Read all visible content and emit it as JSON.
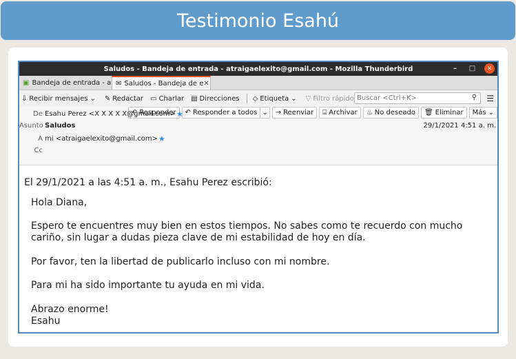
{
  "banner": {
    "title": "Testimonio Esahú"
  },
  "window": {
    "title": "Saludos - Bandeja de entrada - atraigaelexito@gmail.com - Mozilla Thunderbird",
    "controls": [
      "–",
      "□",
      "✕"
    ]
  },
  "tabs": [
    {
      "label": "Bandeja de entrada - atra",
      "icon": "inbox-icon",
      "active": false
    },
    {
      "label": "Saludos - Bandeja de e",
      "icon": "envelope-icon",
      "active": true
    }
  ],
  "toolbar": {
    "get_messages": "Recibir mensajes",
    "write": "Redactar",
    "chat": "Charlar",
    "address_book": "Direcciones",
    "tag": "Etiqueta",
    "quick_filter": "Filtro rápido",
    "search_placeholder": "Buscar <Ctrl+K>"
  },
  "actions": {
    "reply": "Responder",
    "reply_all": "Responder a todos",
    "forward": "Reenviar",
    "archive": "Archivar",
    "junk": "No deseado",
    "delete": "Eliminar",
    "more": "Más"
  },
  "header": {
    "from_label": "De",
    "from_value": "Esahu Perez <X X X X X@gmail.com>",
    "subject_label": "Asunto",
    "subject_value": "Saludos",
    "to_label": "A",
    "to_value": "mi <atraigaelexito@gmail.com>",
    "cc_label": "Cc",
    "date": "29/1/2021 4:51 a. m."
  },
  "body": {
    "quote_intro": "El 29/1/2021 a las 4:51 a. m., Esahu Perez escribió:",
    "lines": [
      "Hola Diana,",
      "Espero te encuentres muy bien en estos tiempos. No sabes como te recuerdo con mucho",
      "cariño, sin lugar a dudas pieza clave de mi estabilidad de hoy en día.",
      "Por favor, ten la libertad de publicarlo incluso con mi nombre.",
      "Para mi ha sido importante tu ayuda en mi vida.",
      "Abrazo enorme!",
      "Esahu"
    ]
  }
}
